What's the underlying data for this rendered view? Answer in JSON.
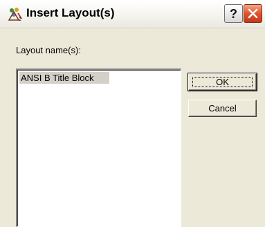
{
  "window": {
    "title": "Insert Layout(s)",
    "icon": "autocad-drawing-app-icon",
    "help_label": "?",
    "close_icon": "close-icon"
  },
  "dialog": {
    "field_label": "Layout name(s):",
    "layouts": [
      "ANSI B Title Block"
    ],
    "selected_index": 0,
    "ok_label": "OK",
    "cancel_label": "Cancel"
  },
  "colors": {
    "dialog_bg": "#ECE9D8",
    "close_red": "#E0542C",
    "selection_bg": "#D4D0C8"
  }
}
